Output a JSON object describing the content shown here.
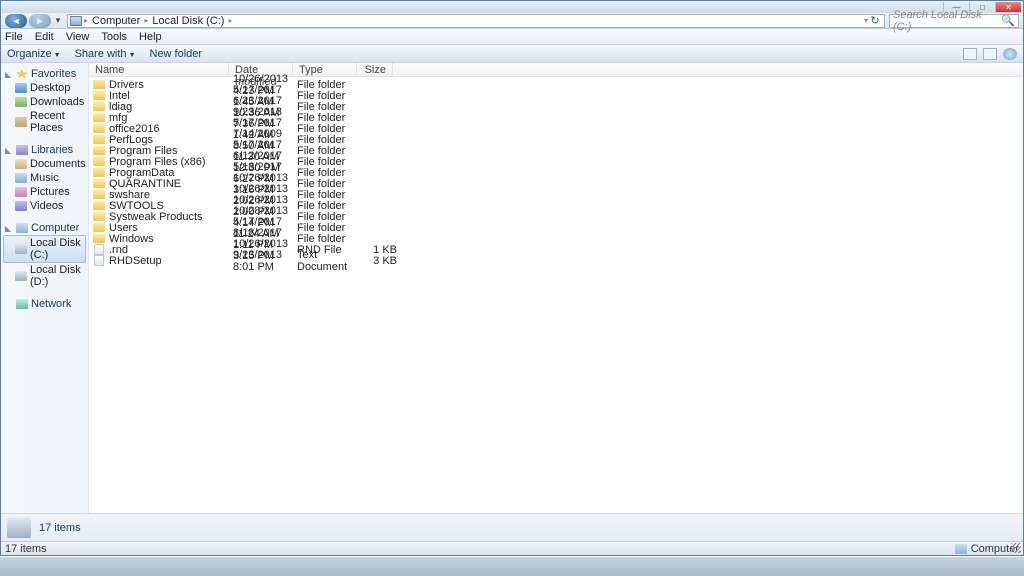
{
  "breadcrumb": {
    "root_icon": "computer",
    "parts": [
      "Computer",
      "Local Disk (C:)"
    ]
  },
  "search": {
    "placeholder": "Search Local Disk (C:)"
  },
  "menu": {
    "file": "File",
    "edit": "Edit",
    "view": "View",
    "tools": "Tools",
    "help": "Help"
  },
  "cmd": {
    "organize": "Organize",
    "share": "Share with",
    "newfolder": "New folder"
  },
  "nav": {
    "favorites": {
      "label": "Favorites",
      "items": [
        {
          "label": "Desktop",
          "ico": "desk"
        },
        {
          "label": "Downloads",
          "ico": "dl"
        },
        {
          "label": "Recent Places",
          "ico": "recent"
        }
      ]
    },
    "libraries": {
      "label": "Libraries",
      "items": [
        {
          "label": "Documents",
          "ico": "doc"
        },
        {
          "label": "Music",
          "ico": "mus"
        },
        {
          "label": "Pictures",
          "ico": "pic"
        },
        {
          "label": "Videos",
          "ico": "vid"
        }
      ]
    },
    "computer": {
      "label": "Computer",
      "items": [
        {
          "label": "Local Disk (C:)",
          "ico": "disk",
          "sel": true
        },
        {
          "label": "Local Disk (D:)",
          "ico": "disk"
        }
      ]
    },
    "network": {
      "label": "Network"
    }
  },
  "columns": {
    "name": "Name",
    "date": "Date modified",
    "type": "Type",
    "size": "Size"
  },
  "files": [
    {
      "name": "Drivers",
      "date": "10/26/2013 4:23 PM",
      "type": "File folder",
      "size": "",
      "ico": "fold"
    },
    {
      "name": "Intel",
      "date": "5/17/2017 1:45 AM",
      "type": "File folder",
      "size": "",
      "ico": "fold"
    },
    {
      "name": "ldiag",
      "date": "6/23/2017 10:36 AM",
      "type": "File folder",
      "size": "",
      "ico": "fold"
    },
    {
      "name": "mfg",
      "date": "9/23/2013 7:36 PM",
      "type": "File folder",
      "size": "",
      "ico": "fold"
    },
    {
      "name": "office2016",
      "date": "5/17/2017 1:42 AM",
      "type": "File folder",
      "size": "",
      "ico": "fold"
    },
    {
      "name": "PerfLogs",
      "date": "7/14/2009 8:50 AM",
      "type": "File folder",
      "size": "",
      "ico": "fold"
    },
    {
      "name": "Program Files",
      "date": "5/17/2017 11:30 AM",
      "type": "File folder",
      "size": "",
      "ico": "fold"
    },
    {
      "name": "Program Files (x86)",
      "date": "6/12/2017 12:30 PM",
      "type": "File folder",
      "size": "",
      "ico": "fold"
    },
    {
      "name": "ProgramData",
      "date": "5/18/2017 6:27 PM",
      "type": "File folder",
      "size": "",
      "ico": "fold"
    },
    {
      "name": "QUARANTINE",
      "date": "10/26/2013 3:16 PM",
      "type": "File folder",
      "size": "",
      "ico": "fold"
    },
    {
      "name": "swshare",
      "date": "10/26/2013 2:02 PM",
      "type": "File folder",
      "size": "",
      "ico": "fold"
    },
    {
      "name": "SWTOOLS",
      "date": "10/26/2013 2:00 PM",
      "type": "File folder",
      "size": "",
      "ico": "fold"
    },
    {
      "name": "Systweak Products",
      "date": "10/28/2013 4:14 PM",
      "type": "File folder",
      "size": "",
      "ico": "fold"
    },
    {
      "name": "Users",
      "date": "5/17/2017 11:24 AM",
      "type": "File folder",
      "size": "",
      "ico": "fold"
    },
    {
      "name": "Windows",
      "date": "8/18/2017 1:11 PM",
      "type": "File folder",
      "size": "",
      "ico": "fold"
    },
    {
      "name": ".rnd",
      "date": "10/26/2013 3:15 PM",
      "type": "RND File",
      "size": "1 KB",
      "ico": "file"
    },
    {
      "name": "RHDSetup",
      "date": "9/23/2013 8:01 PM",
      "type": "Text Document",
      "size": "3 KB",
      "ico": "file"
    }
  ],
  "details": {
    "count": "17 items"
  },
  "status": {
    "left": "17 items",
    "right": "Computer"
  }
}
